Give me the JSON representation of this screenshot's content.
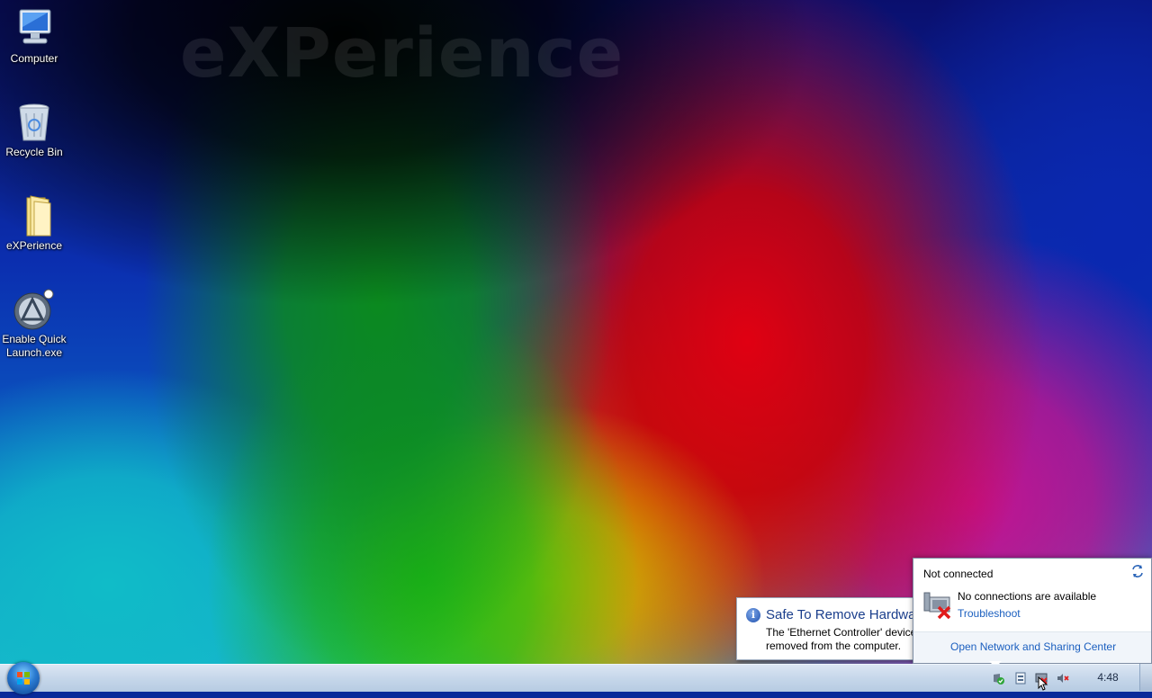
{
  "wallpaper": {
    "watermark_text": "eXPerience"
  },
  "desktop": {
    "icons": [
      {
        "label": "Computer",
        "icon": "computer-icon"
      },
      {
        "label": "Recycle Bin",
        "icon": "recycle-bin-icon"
      },
      {
        "label": "eXPerience",
        "icon": "folder-icon"
      },
      {
        "label": "Enable Quick Launch.exe",
        "icon": "app-icon"
      }
    ]
  },
  "balloon": {
    "icon": "info-icon",
    "title": "Safe To Remove Hardware",
    "body_line1": "The 'Ethernet Controller' device can now be safely",
    "body_line2": "removed from the computer."
  },
  "network_flyout": {
    "status": "Not connected",
    "message": "No connections are available",
    "troubleshoot_link": "Troubleshoot",
    "footer_link": "Open Network and Sharing Center",
    "icons": [
      "refresh-icon",
      "network-disconnected-icon"
    ]
  },
  "taskbar": {
    "clock": "4:48",
    "tray_icons": [
      "action-center-icon",
      "safely-remove-icon",
      "network-icon",
      "volume-muted-icon"
    ],
    "colors": {
      "accent": "#1b5fbf",
      "taskbar": "#c6d7ea"
    }
  }
}
